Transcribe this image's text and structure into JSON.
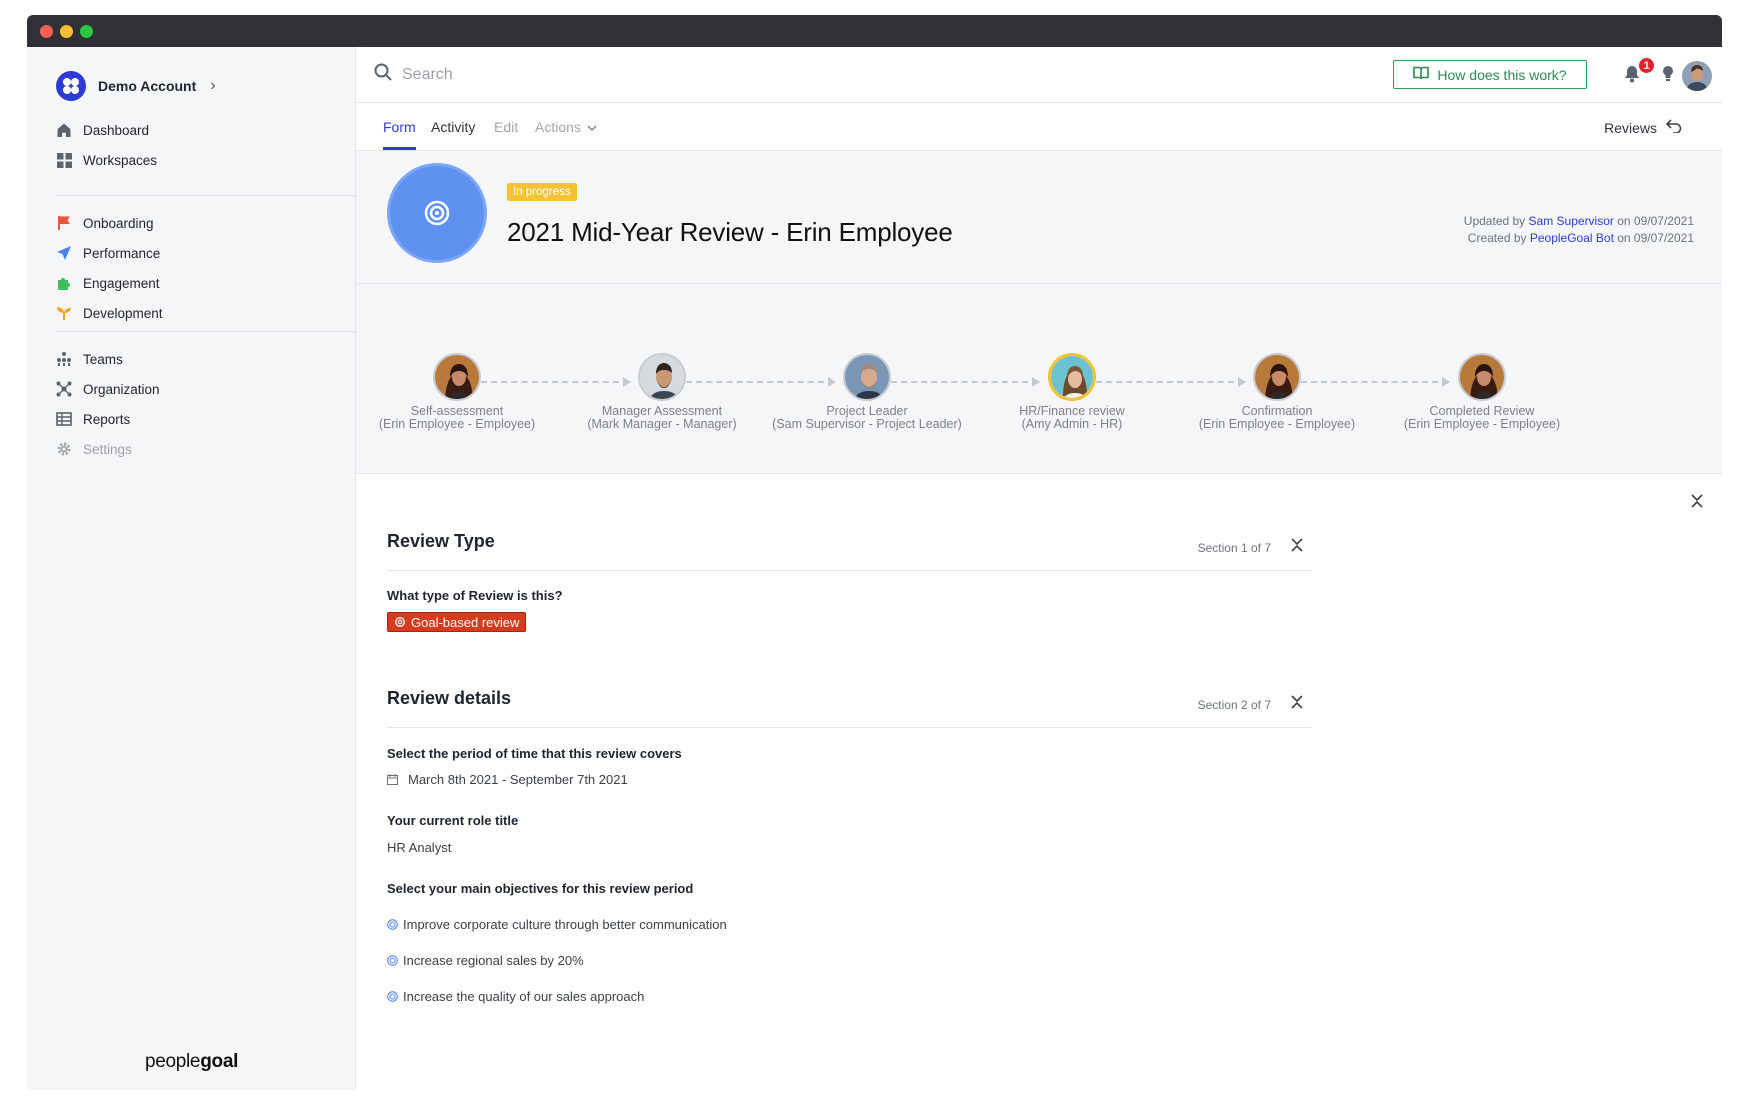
{
  "account": {
    "name": "Demo Account"
  },
  "sidebar": {
    "main": [
      {
        "label": "Dashboard",
        "icon": "home-icon"
      },
      {
        "label": "Workspaces",
        "icon": "grid-icon"
      }
    ],
    "apps": [
      {
        "label": "Onboarding",
        "icon": "flag-icon",
        "color": "#f0533a"
      },
      {
        "label": "Performance",
        "icon": "paper-plane-icon",
        "color": "#4a7ff0"
      },
      {
        "label": "Engagement",
        "icon": "puzzle-icon",
        "color": "#3fbf5c"
      },
      {
        "label": "Development",
        "icon": "sprout-icon",
        "color": "#f2a51a"
      }
    ],
    "admin": [
      {
        "label": "Teams",
        "icon": "team-icon"
      },
      {
        "label": "Organization",
        "icon": "org-icon"
      },
      {
        "label": "Reports",
        "icon": "table-icon"
      },
      {
        "label": "Settings",
        "icon": "gear-icon"
      }
    ],
    "brand_regular": "people",
    "brand_bold": "goal"
  },
  "header": {
    "search_placeholder": "Search",
    "help_label": "How does this work?",
    "notification_count": "1"
  },
  "tabs": {
    "form": "Form",
    "activity": "Activity",
    "edit": "Edit",
    "actions": "Actions",
    "reviews": "Reviews"
  },
  "review": {
    "status": "In progress",
    "title": "2021 Mid-Year Review - Erin Employee",
    "updated_prefix": "Updated by",
    "updated_by": "Sam Supervisor",
    "updated_on": "on 09/07/2021",
    "created_prefix": "Created by",
    "created_by": "PeopleGoal Bot",
    "created_on": "on 09/07/2021"
  },
  "steps": [
    {
      "name": "Self-assessment",
      "who": "(Erin Employee - Employee)"
    },
    {
      "name": "Manager Assessment",
      "who": "(Mark Manager - Manager)"
    },
    {
      "name": "Project Leader",
      "who": "(Sam Supervisor - Project Leader)"
    },
    {
      "name": "HR/Finance review",
      "who": "(Amy Admin - HR)"
    },
    {
      "name": "Confirmation",
      "who": "(Erin Employee - Employee)"
    },
    {
      "name": "Completed Review",
      "who": "(Erin Employee - Employee)"
    }
  ],
  "sections": [
    {
      "title": "Review Type",
      "count": "Section 1 of 7",
      "question": "What type of Review is this?",
      "answer": "Goal-based review"
    },
    {
      "title": "Review details",
      "count": "Section 2 of 7",
      "q1": "Select the period of time that this review covers",
      "a1": "March 8th 2021 - September 7th 2021",
      "q2": "Your current role title",
      "a2": "HR Analyst",
      "q3": "Select your main objectives for this review period",
      "objectives": [
        "Improve corporate culture through better communication",
        "Increase regional sales by 20%",
        "Increase the quality of our sales approach"
      ]
    }
  ],
  "colors": {
    "accent": "#2c3bd6",
    "status": "#f5c233",
    "tag": "#d63a1f",
    "help_green": "#2e9b56"
  }
}
